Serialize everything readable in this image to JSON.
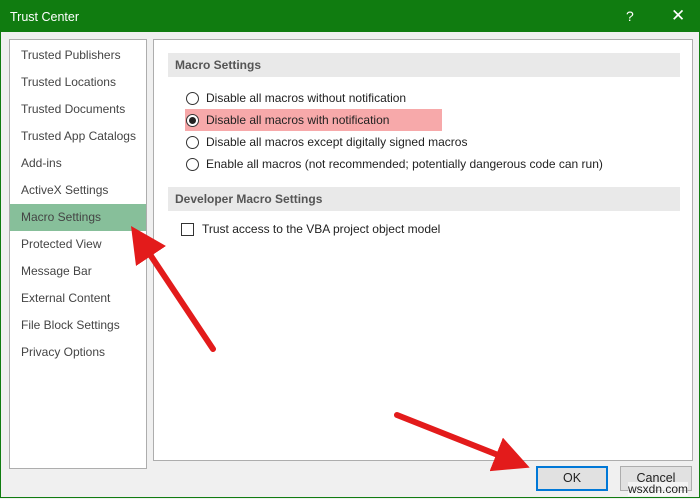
{
  "window": {
    "title": "Trust Center",
    "help": "?",
    "close": "✕"
  },
  "sidebar": {
    "items": [
      {
        "label": "Trusted Publishers"
      },
      {
        "label": "Trusted Locations"
      },
      {
        "label": "Trusted Documents"
      },
      {
        "label": "Trusted App Catalogs"
      },
      {
        "label": "Add-ins"
      },
      {
        "label": "ActiveX Settings"
      },
      {
        "label": "Macro Settings",
        "selected": true
      },
      {
        "label": "Protected View"
      },
      {
        "label": "Message Bar"
      },
      {
        "label": "External Content"
      },
      {
        "label": "File Block Settings"
      },
      {
        "label": "Privacy Options"
      }
    ]
  },
  "macro": {
    "heading": "Macro Settings",
    "options": [
      {
        "label": "Disable all macros without notification",
        "checked": false
      },
      {
        "label": "Disable all macros with notification",
        "checked": true
      },
      {
        "label": "Disable all macros except digitally signed macros",
        "checked": false
      },
      {
        "label": "Enable all macros (not recommended; potentially dangerous code can run)",
        "checked": false
      }
    ]
  },
  "developer": {
    "heading": "Developer Macro Settings",
    "vba_label": "Trust access to the VBA project object model",
    "vba_checked": false
  },
  "buttons": {
    "ok": "OK",
    "cancel": "Cancel"
  },
  "watermark": "wsxdn.com",
  "colors": {
    "titlebar": "#107c10",
    "selected": "#87bf9a",
    "highlight": "#f7a9aa",
    "arrow": "#e31b1b"
  }
}
